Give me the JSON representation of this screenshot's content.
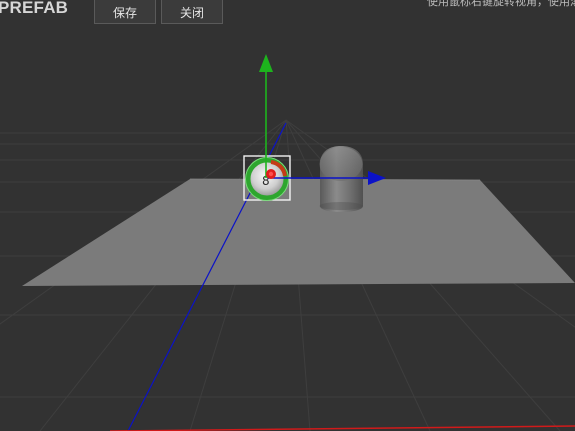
{
  "header": {
    "title": "PREFAB",
    "save_label": "保存",
    "close_label": "关闭",
    "hint_text": "使用鼠标右键旋转视角，使用滚"
  },
  "scene": {
    "background_color": "#323232",
    "ground_color": "#7b7b7b",
    "grid_color": "#4a4a4a",
    "axis_colors": {
      "x": "#0b12c8",
      "y": "#1db41d",
      "z": "#d11a1a"
    },
    "gizmo_glyph": "8",
    "objects": [
      "plane",
      "capsule",
      "sphere"
    ]
  }
}
